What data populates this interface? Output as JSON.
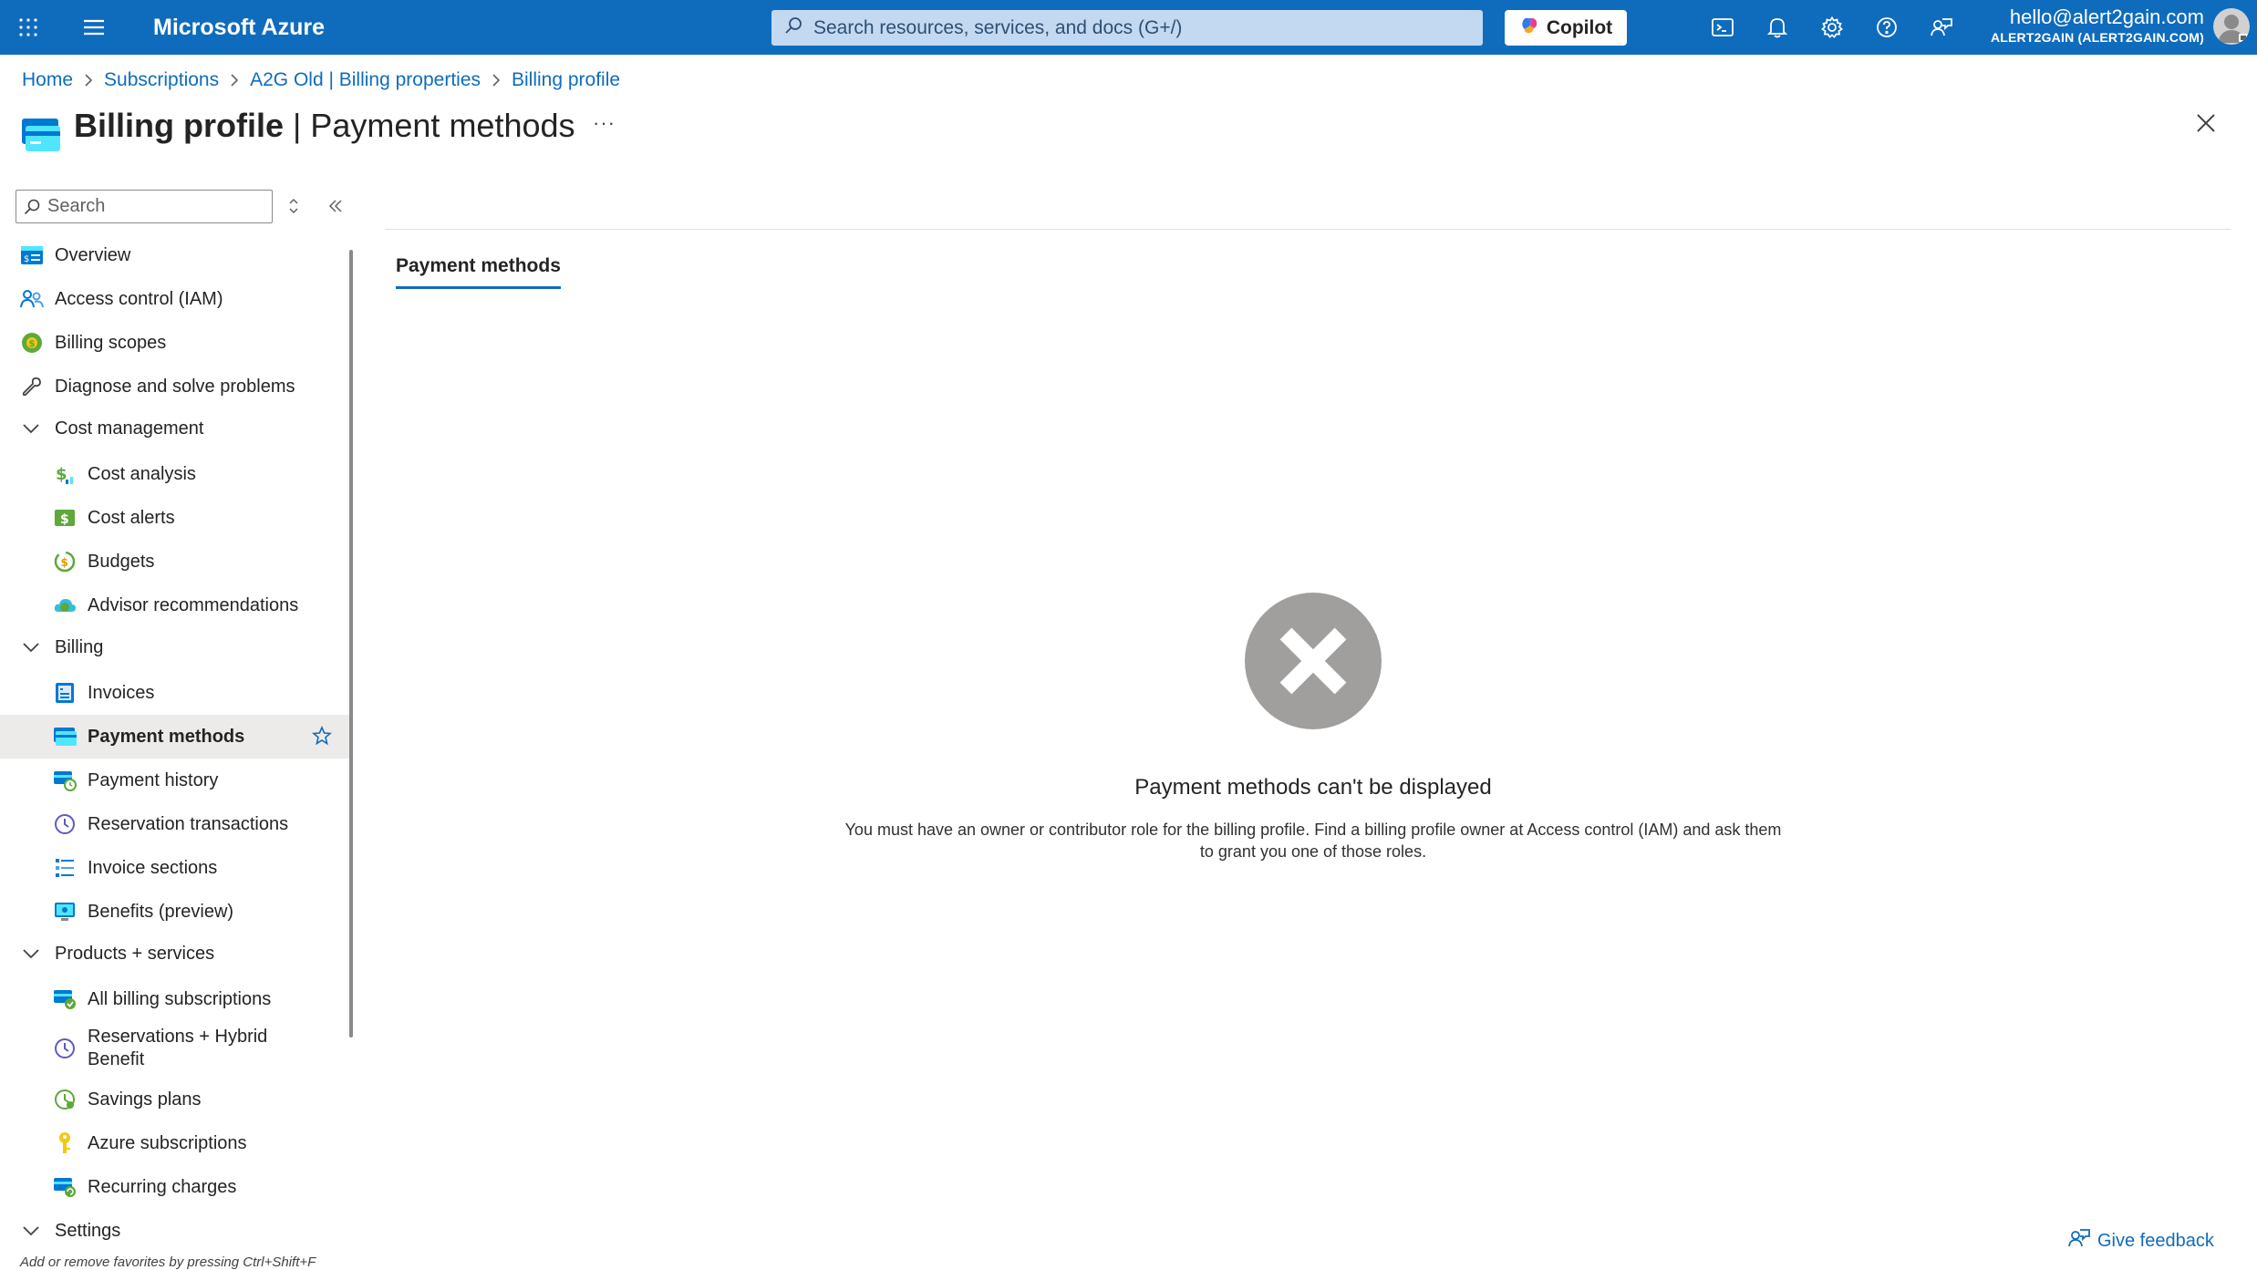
{
  "topbar": {
    "brand": "Microsoft Azure",
    "search_placeholder": "Search resources, services, and docs (G+/)",
    "copilot_label": "Copilot",
    "account_email": "hello@alert2gain.com",
    "account_tenant": "ALERT2GAIN (ALERT2GAIN.COM)",
    "icons": [
      "portal-menu-icon",
      "hamburger-icon",
      "cloud-shell-icon",
      "notifications-icon",
      "settings-icon",
      "help-icon",
      "feedback-icon"
    ]
  },
  "breadcrumb": [
    "Home",
    "Subscriptions",
    "A2G Old | Billing properties",
    "Billing profile"
  ],
  "title": {
    "strong": "Billing profile",
    "rest": "| Payment methods",
    "more": "···"
  },
  "nav": {
    "search_placeholder": "Search",
    "items": [
      {
        "label": "Overview",
        "icon": "overview-icon"
      },
      {
        "label": "Access control (IAM)",
        "icon": "iam-icon"
      },
      {
        "label": "Billing scopes",
        "icon": "billing-scopes-icon"
      },
      {
        "label": "Diagnose and solve problems",
        "icon": "wrench-icon"
      },
      {
        "label": "Cost management",
        "group": true
      },
      {
        "label": "Cost analysis",
        "icon": "cost-analysis-icon"
      },
      {
        "label": "Cost alerts",
        "icon": "cost-alerts-icon"
      },
      {
        "label": "Budgets",
        "icon": "budgets-icon"
      },
      {
        "label": "Advisor recommendations",
        "icon": "advisor-icon"
      },
      {
        "label": "Billing",
        "group": true
      },
      {
        "label": "Invoices",
        "icon": "invoices-icon"
      },
      {
        "label": "Payment methods",
        "icon": "payment-methods-icon",
        "selected": true
      },
      {
        "label": "Payment history",
        "icon": "payment-history-icon"
      },
      {
        "label": "Reservation transactions",
        "icon": "reservation-icon"
      },
      {
        "label": "Invoice sections",
        "icon": "invoice-sections-icon"
      },
      {
        "label": "Benefits (preview)",
        "icon": "benefits-icon"
      },
      {
        "label": "Products + services",
        "group": true
      },
      {
        "label": "All billing subscriptions",
        "icon": "subscriptions-icon"
      },
      {
        "label": "Reservations + Hybrid",
        "label2": "Benefit",
        "icon": "reservations-hybrid-icon"
      },
      {
        "label": "Savings plans",
        "icon": "savings-plans-icon"
      },
      {
        "label": "Azure subscriptions",
        "icon": "key-icon"
      },
      {
        "label": "Recurring charges",
        "icon": "recurring-charges-icon"
      },
      {
        "label": "Settings",
        "group": true
      }
    ],
    "favorites_hint": "Add or remove favorites by pressing Ctrl+Shift+F"
  },
  "main": {
    "tab": "Payment methods",
    "error_title": "Payment methods can't be displayed",
    "error_line1": "You must have an owner or contributor role for the billing profile. Find a billing profile owner at Access control (IAM) and ask them",
    "error_line2": "to grant you one of those roles.",
    "feedback_label": "Give feedback"
  },
  "colors": {
    "brand": "#0f6cbd",
    "selected_bg": "#edebe9",
    "error_icon": "#a19f9d"
  }
}
